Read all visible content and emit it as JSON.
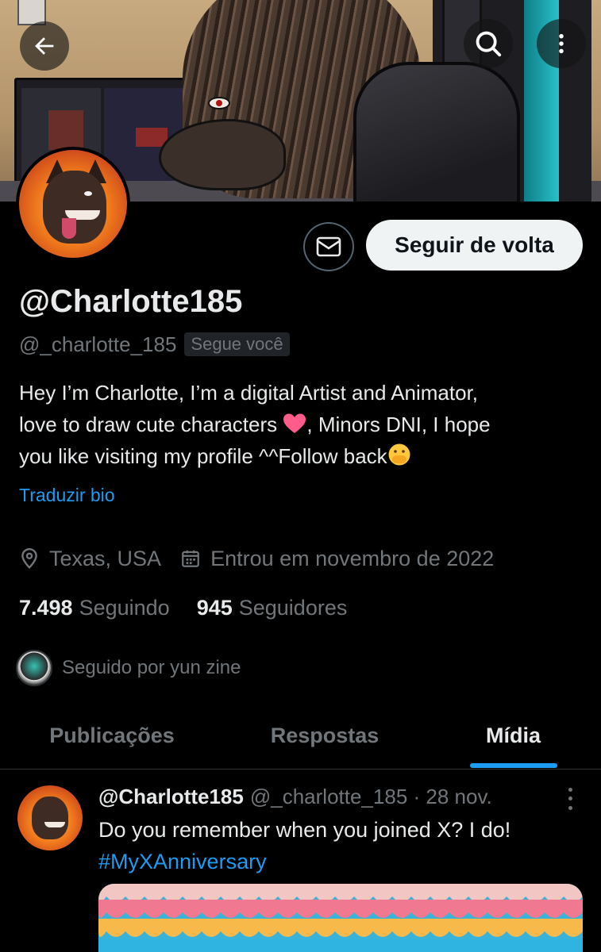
{
  "header": {
    "back_icon": "arrow-left-icon",
    "search_icon": "search-icon",
    "more_icon": "more-vertical-icon"
  },
  "profile": {
    "display_name": "@Charlotte185",
    "handle": "@_charlotte_185",
    "follows_you_badge": "Segue você",
    "follow_back_label": "Seguir de volta",
    "message_icon": "mail-icon",
    "bio": {
      "line1": "Hey I’m Charlotte, I’m a digital Artist and Animator,",
      "line2a": "love to draw cute characters",
      "line2b": ", Minors DNI, I hope",
      "line3": "you like visiting my profile ^^Follow back"
    },
    "translate_bio": "Traduzir bio",
    "location": "Texas, USA",
    "joined": "Entrou em novembro de 2022",
    "following_count": "7.498",
    "following_label": "Seguindo",
    "followers_count": "945",
    "followers_label": "Seguidores",
    "followed_by": "Seguido por yun zine"
  },
  "tabs": [
    {
      "label": "Publicações",
      "active": false
    },
    {
      "label": "Respostas",
      "active": false
    },
    {
      "label": "Mídia",
      "active": true
    }
  ],
  "post": {
    "author_name": "@Charlotte185",
    "author_meta": "@_charlotte_185 · 28 nov.",
    "text_line1": "Do you remember when you joined X? I do!",
    "hashtag": "#MyXAnniversary"
  },
  "colors": {
    "background": "#000000",
    "accent": "#1d9bf0",
    "muted": "#71767b",
    "text": "#e7e9ea",
    "follow_button_bg": "#eff3f4"
  }
}
